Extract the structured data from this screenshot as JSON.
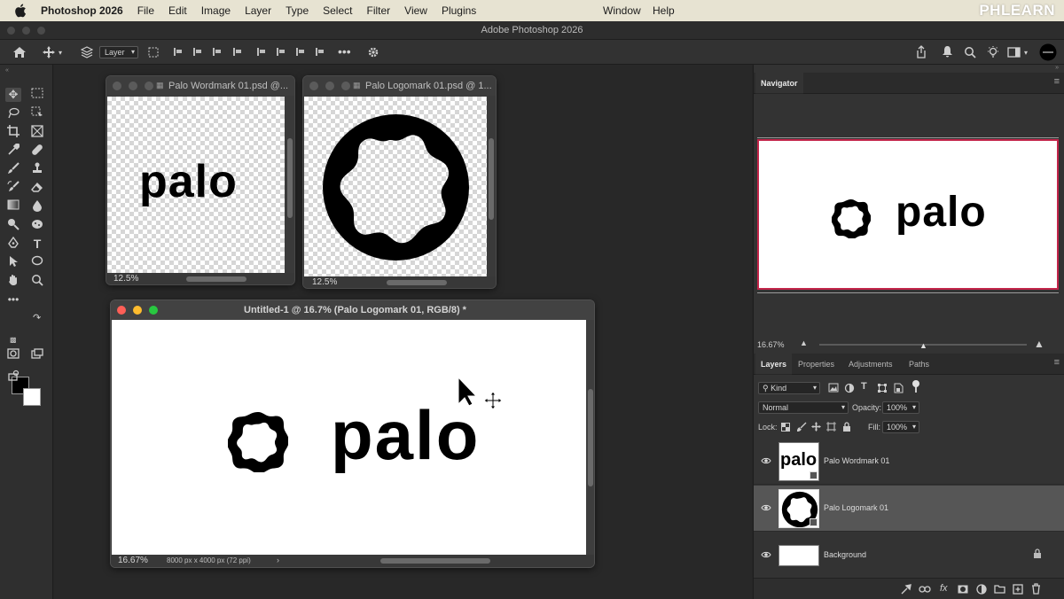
{
  "menubar": {
    "app_name": "Photoshop 2026",
    "items": [
      "File",
      "Edit",
      "Image",
      "Layer",
      "Type",
      "Select",
      "Filter",
      "View",
      "Plugins"
    ],
    "right_items": [
      "Window",
      "Help"
    ],
    "brand": "PHLEARN"
  },
  "window": {
    "title": "Adobe Photoshop 2026"
  },
  "options_bar": {
    "layer_select": "Layer"
  },
  "documents": [
    {
      "title": "Palo Wordmark 01.psd @...",
      "zoom": "12.5%",
      "content_text": "palo"
    },
    {
      "title": "Palo Logomark 01.psd @ 1...",
      "zoom": "12.5%"
    },
    {
      "title": "Untitled-1 @ 16.7% (Palo Logomark 01, RGB/8) *",
      "zoom": "16.67%",
      "doc_info": "8000 px x 4000 px (72 ppi)",
      "content_text": "palo"
    }
  ],
  "navigator": {
    "tab": "Navigator",
    "zoom": "16.67%",
    "preview_text": "palo",
    "accent": "#c3254a",
    "zoom_level": 0.5
  },
  "layers_panel": {
    "tabs": [
      "Layers",
      "Properties",
      "Adjustments",
      "Paths"
    ],
    "filter_label": "Kind",
    "blend_mode": "Normal",
    "opacity_label": "Opacity:",
    "opacity_value": "100%",
    "lock_label": "Lock:",
    "fill_label": "Fill:",
    "fill_value": "100%",
    "layers": [
      {
        "name": "Palo Wordmark 01",
        "thumb_text": "palo",
        "selected": false
      },
      {
        "name": "Palo Logomark 01",
        "selected": true
      },
      {
        "name": "Background",
        "selected": false
      }
    ]
  },
  "colors": {
    "foreground": "#000000",
    "background": "#ffffff",
    "selection_outline": "#c3254a"
  }
}
